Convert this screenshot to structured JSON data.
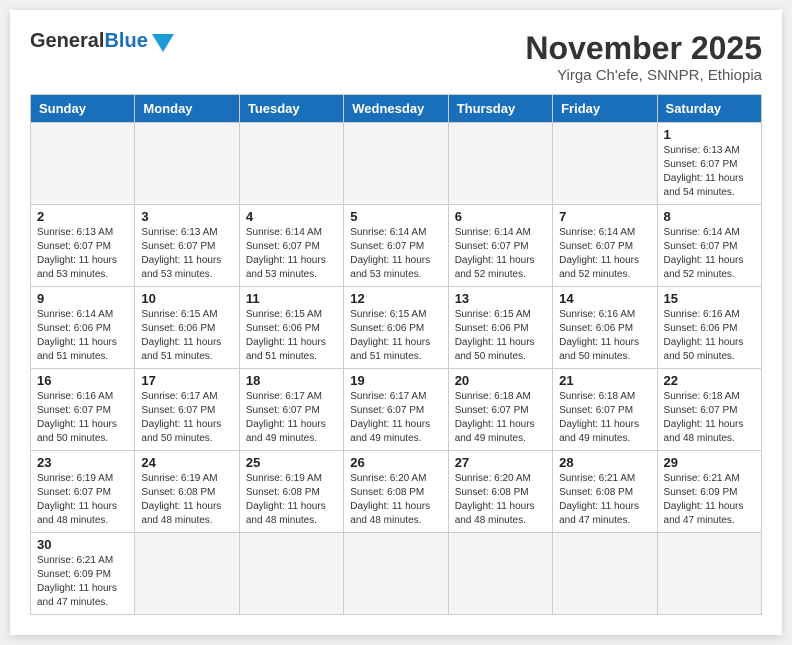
{
  "header": {
    "logo_general": "General",
    "logo_blue": "Blue",
    "month_year": "November 2025",
    "location": "Yirga Ch'efe, SNNPR, Ethiopia"
  },
  "days_of_week": [
    "Sunday",
    "Monday",
    "Tuesday",
    "Wednesday",
    "Thursday",
    "Friday",
    "Saturday"
  ],
  "weeks": [
    [
      {
        "day": "",
        "empty": true
      },
      {
        "day": "",
        "empty": true
      },
      {
        "day": "",
        "empty": true
      },
      {
        "day": "",
        "empty": true
      },
      {
        "day": "",
        "empty": true
      },
      {
        "day": "",
        "empty": true
      },
      {
        "day": "1",
        "sunrise": "Sunrise: 6:13 AM",
        "sunset": "Sunset: 6:07 PM",
        "daylight": "Daylight: 11 hours and 54 minutes."
      }
    ],
    [
      {
        "day": "2",
        "sunrise": "Sunrise: 6:13 AM",
        "sunset": "Sunset: 6:07 PM",
        "daylight": "Daylight: 11 hours and 53 minutes."
      },
      {
        "day": "3",
        "sunrise": "Sunrise: 6:13 AM",
        "sunset": "Sunset: 6:07 PM",
        "daylight": "Daylight: 11 hours and 53 minutes."
      },
      {
        "day": "4",
        "sunrise": "Sunrise: 6:14 AM",
        "sunset": "Sunset: 6:07 PM",
        "daylight": "Daylight: 11 hours and 53 minutes."
      },
      {
        "day": "5",
        "sunrise": "Sunrise: 6:14 AM",
        "sunset": "Sunset: 6:07 PM",
        "daylight": "Daylight: 11 hours and 53 minutes."
      },
      {
        "day": "6",
        "sunrise": "Sunrise: 6:14 AM",
        "sunset": "Sunset: 6:07 PM",
        "daylight": "Daylight: 11 hours and 52 minutes."
      },
      {
        "day": "7",
        "sunrise": "Sunrise: 6:14 AM",
        "sunset": "Sunset: 6:07 PM",
        "daylight": "Daylight: 11 hours and 52 minutes."
      },
      {
        "day": "8",
        "sunrise": "Sunrise: 6:14 AM",
        "sunset": "Sunset: 6:07 PM",
        "daylight": "Daylight: 11 hours and 52 minutes."
      }
    ],
    [
      {
        "day": "9",
        "sunrise": "Sunrise: 6:14 AM",
        "sunset": "Sunset: 6:06 PM",
        "daylight": "Daylight: 11 hours and 51 minutes."
      },
      {
        "day": "10",
        "sunrise": "Sunrise: 6:15 AM",
        "sunset": "Sunset: 6:06 PM",
        "daylight": "Daylight: 11 hours and 51 minutes."
      },
      {
        "day": "11",
        "sunrise": "Sunrise: 6:15 AM",
        "sunset": "Sunset: 6:06 PM",
        "daylight": "Daylight: 11 hours and 51 minutes."
      },
      {
        "day": "12",
        "sunrise": "Sunrise: 6:15 AM",
        "sunset": "Sunset: 6:06 PM",
        "daylight": "Daylight: 11 hours and 51 minutes."
      },
      {
        "day": "13",
        "sunrise": "Sunrise: 6:15 AM",
        "sunset": "Sunset: 6:06 PM",
        "daylight": "Daylight: 11 hours and 50 minutes."
      },
      {
        "day": "14",
        "sunrise": "Sunrise: 6:16 AM",
        "sunset": "Sunset: 6:06 PM",
        "daylight": "Daylight: 11 hours and 50 minutes."
      },
      {
        "day": "15",
        "sunrise": "Sunrise: 6:16 AM",
        "sunset": "Sunset: 6:06 PM",
        "daylight": "Daylight: 11 hours and 50 minutes."
      }
    ],
    [
      {
        "day": "16",
        "sunrise": "Sunrise: 6:16 AM",
        "sunset": "Sunset: 6:07 PM",
        "daylight": "Daylight: 11 hours and 50 minutes."
      },
      {
        "day": "17",
        "sunrise": "Sunrise: 6:17 AM",
        "sunset": "Sunset: 6:07 PM",
        "daylight": "Daylight: 11 hours and 50 minutes."
      },
      {
        "day": "18",
        "sunrise": "Sunrise: 6:17 AM",
        "sunset": "Sunset: 6:07 PM",
        "daylight": "Daylight: 11 hours and 49 minutes."
      },
      {
        "day": "19",
        "sunrise": "Sunrise: 6:17 AM",
        "sunset": "Sunset: 6:07 PM",
        "daylight": "Daylight: 11 hours and 49 minutes."
      },
      {
        "day": "20",
        "sunrise": "Sunrise: 6:18 AM",
        "sunset": "Sunset: 6:07 PM",
        "daylight": "Daylight: 11 hours and 49 minutes."
      },
      {
        "day": "21",
        "sunrise": "Sunrise: 6:18 AM",
        "sunset": "Sunset: 6:07 PM",
        "daylight": "Daylight: 11 hours and 49 minutes."
      },
      {
        "day": "22",
        "sunrise": "Sunrise: 6:18 AM",
        "sunset": "Sunset: 6:07 PM",
        "daylight": "Daylight: 11 hours and 48 minutes."
      }
    ],
    [
      {
        "day": "23",
        "sunrise": "Sunrise: 6:19 AM",
        "sunset": "Sunset: 6:07 PM",
        "daylight": "Daylight: 11 hours and 48 minutes."
      },
      {
        "day": "24",
        "sunrise": "Sunrise: 6:19 AM",
        "sunset": "Sunset: 6:08 PM",
        "daylight": "Daylight: 11 hours and 48 minutes."
      },
      {
        "day": "25",
        "sunrise": "Sunrise: 6:19 AM",
        "sunset": "Sunset: 6:08 PM",
        "daylight": "Daylight: 11 hours and 48 minutes."
      },
      {
        "day": "26",
        "sunrise": "Sunrise: 6:20 AM",
        "sunset": "Sunset: 6:08 PM",
        "daylight": "Daylight: 11 hours and 48 minutes."
      },
      {
        "day": "27",
        "sunrise": "Sunrise: 6:20 AM",
        "sunset": "Sunset: 6:08 PM",
        "daylight": "Daylight: 11 hours and 48 minutes."
      },
      {
        "day": "28",
        "sunrise": "Sunrise: 6:21 AM",
        "sunset": "Sunset: 6:08 PM",
        "daylight": "Daylight: 11 hours and 47 minutes."
      },
      {
        "day": "29",
        "sunrise": "Sunrise: 6:21 AM",
        "sunset": "Sunset: 6:09 PM",
        "daylight": "Daylight: 11 hours and 47 minutes."
      }
    ],
    [
      {
        "day": "30",
        "sunrise": "Sunrise: 6:21 AM",
        "sunset": "Sunset: 6:09 PM",
        "daylight": "Daylight: 11 hours and 47 minutes."
      },
      {
        "day": "",
        "empty": true
      },
      {
        "day": "",
        "empty": true
      },
      {
        "day": "",
        "empty": true
      },
      {
        "day": "",
        "empty": true
      },
      {
        "day": "",
        "empty": true
      },
      {
        "day": "",
        "empty": true
      }
    ]
  ]
}
